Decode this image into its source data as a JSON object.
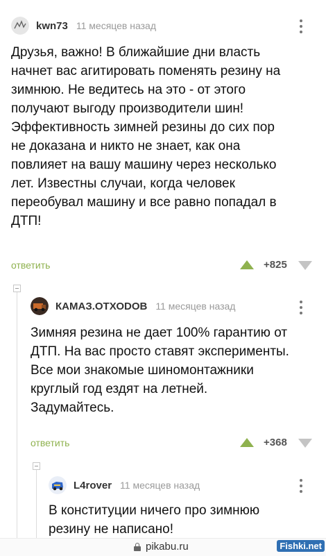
{
  "comments": [
    {
      "username": "kwn73",
      "time": "11 месяцев назад",
      "lines": [
        "Друзья, важно! В ближайшие дни власть",
        "начнет вас агитировать поменять резину на",
        "зимнюю. Не ведитесь на это - от этого",
        "получают выгоду производители шин!",
        "Эффективность зимней резины до сих пор",
        "не доказана и никто не знает, как она",
        "повлияет на вашу машину через несколько",
        "лет. Известны случаи, когда человек",
        "переобувал машину и все равно попадал в",
        "ДТП!"
      ],
      "reply_label": "ответить",
      "rating": "+825"
    },
    {
      "username": "КАМАЗ.ОТХОDОВ",
      "time": "11 месяцев назад",
      "lines": [
        "Зимняя резина не дает 100% гарантию от",
        "ДТП. На вас просто ставят эксперименты.",
        "Все мои знакомые шиномонтажники",
        "круглый год ездят на летней.",
        "Задумайтесь."
      ],
      "reply_label": "ответить",
      "rating": "+368"
    },
    {
      "username": "L4rover",
      "time": "11 месяцев назад",
      "lines": [
        "В конституции ничего про зимнюю",
        "резину не написано!"
      ]
    }
  ],
  "footer": {
    "site": "pikabu.ru",
    "watermark": "Fishki.net"
  },
  "colors": {
    "accent": "#8fb24f",
    "downvote": "#c4c4c4",
    "meta_text": "#9a9a9a"
  },
  "icons": [
    "avatar-sketch",
    "avatar-truck",
    "avatar-rover",
    "kebab-menu-icon",
    "upvote-arrow-icon",
    "downvote-arrow-icon",
    "collapse-icon",
    "lock-icon"
  ]
}
